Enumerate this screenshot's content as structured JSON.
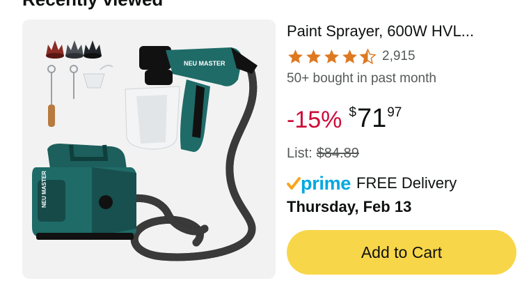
{
  "section": {
    "title": "Recently viewed"
  },
  "product": {
    "title": "Paint Sprayer, 600W HVL...",
    "rating": 4.5,
    "review_count": "2,915",
    "bought_text": "50+ bought in past month",
    "discount": "-15%",
    "price_symbol": "$",
    "price_whole": "71",
    "price_fraction": "97",
    "list_label": "List:",
    "list_price": "$84.89",
    "prime_label": "prime",
    "delivery_text": "FREE Delivery",
    "delivery_date": "Thursday, Feb 13",
    "brand_text": "NEU MASTER"
  },
  "actions": {
    "add_to_cart": "Add to Cart"
  },
  "colors": {
    "star": "#de7921",
    "discount": "#cc0c39",
    "prime": "#00a8e1",
    "button": "#f8d649",
    "teal_body": "#1f6b68"
  },
  "icons": {
    "star": "star-icon",
    "prime_check": "check-icon"
  }
}
